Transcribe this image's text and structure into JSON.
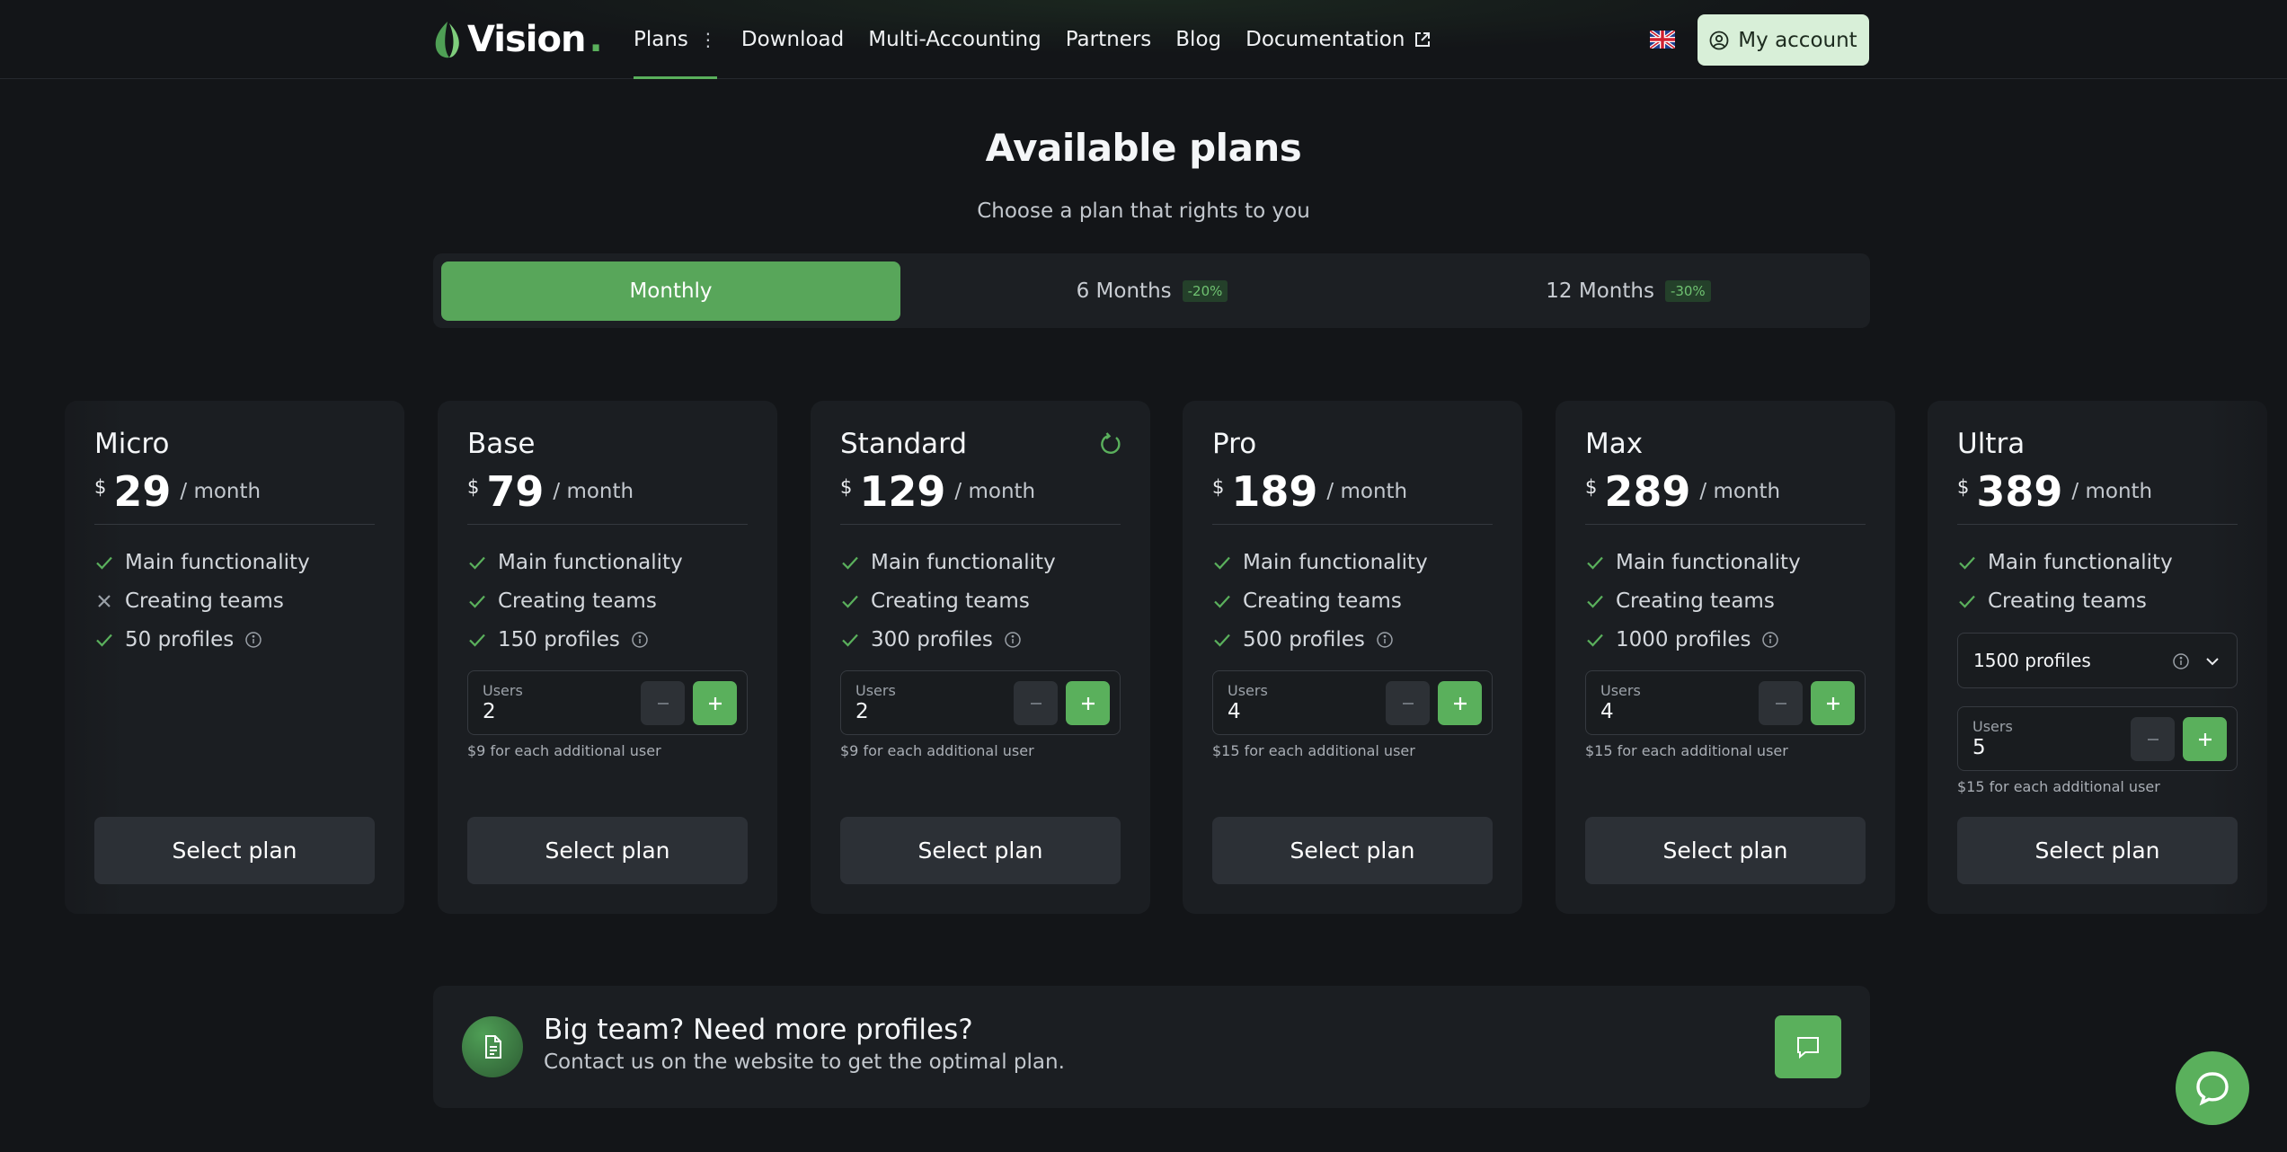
{
  "header": {
    "logo_text": "Vision",
    "logo_dot": ".",
    "nav": [
      {
        "label": "Plans",
        "active": true
      },
      {
        "label": "Download"
      },
      {
        "label": "Multi-Accounting"
      },
      {
        "label": "Partners"
      },
      {
        "label": "Blog"
      },
      {
        "label": "Documentation"
      }
    ],
    "account_label": "My account"
  },
  "hero": {
    "title": "Available plans",
    "subtitle": "Choose a plan that rights to you"
  },
  "periods": [
    {
      "label": "Monthly",
      "badge": "",
      "active": true
    },
    {
      "label": "6 Months",
      "badge": "-20%"
    },
    {
      "label": "12 Months",
      "badge": "-30%"
    }
  ],
  "currency": "$",
  "per_label": "/ month",
  "select_label": "Select plan",
  "users_label": "Users",
  "plans": [
    {
      "name": "Micro",
      "price": "29",
      "features": [
        "Main functionality",
        "Creating teams",
        "50 profiles"
      ],
      "feature_flags": [
        true,
        false,
        true
      ]
    },
    {
      "name": "Base",
      "price": "79",
      "features": [
        "Main functionality",
        "Creating teams",
        "150 profiles"
      ],
      "users": "2",
      "extra": "$9 for each additional user"
    },
    {
      "name": "Standard",
      "price": "129",
      "features": [
        "Main functionality",
        "Creating teams",
        "300 profiles"
      ],
      "users": "2",
      "extra": "$9 for each additional user"
    },
    {
      "name": "Pro",
      "price": "189",
      "features": [
        "Main functionality",
        "Creating teams",
        "500 profiles"
      ],
      "users": "4",
      "extra": "$15 for each additional user"
    },
    {
      "name": "Max",
      "price": "289",
      "features": [
        "Main functionality",
        "Creating teams",
        "1000 profiles"
      ],
      "users": "4",
      "extra": "$15 for each additional user"
    },
    {
      "name": "Ultra",
      "price": "389",
      "features": [
        "Main functionality",
        "Creating teams"
      ],
      "profiles_select": "1500 profiles",
      "users": "5",
      "extra": "$15 for each additional user"
    }
  ],
  "banner": {
    "title": "Big team? Need more profiles?",
    "text": "Contact us on the website to get the optimal plan."
  },
  "colors": {
    "accent": "#5ab05c",
    "background": "#131518",
    "card": "#1b1e22",
    "account_button": "#d8efd8"
  },
  "icons": [
    "leaf-logo-icon",
    "more-dots-icon",
    "external-link-icon",
    "uk-flag-icon",
    "user-circle-icon",
    "refresh-icon",
    "check-icon",
    "x-icon",
    "info-icon",
    "minus-icon",
    "plus-icon",
    "chevron-down-icon",
    "document-icon",
    "message-icon",
    "chat-icon"
  ]
}
